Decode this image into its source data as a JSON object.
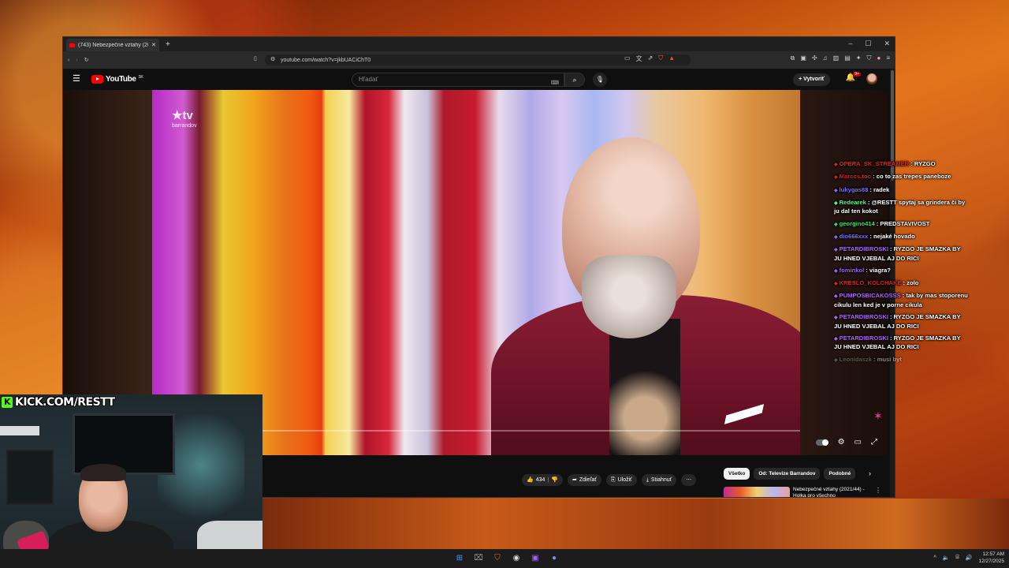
{
  "browser": {
    "tab_title": "(743) Nebezpečné vztahy (2021/...",
    "new_tab": "+",
    "url": "youtube.com/watch?v=jkbUACiChT0",
    "window_controls": [
      "–",
      "☐",
      "✕"
    ]
  },
  "youtube": {
    "logo_text": "YouTube",
    "region": "SK",
    "search_placeholder": "Hľadať",
    "create_label": "Vytvoriť",
    "notif_count": "9+",
    "video": {
      "channel_watermark": "tv",
      "channel_watermark_sub": "barrandov",
      "autoplay_on": true
    },
    "actions": {
      "likes": "434",
      "share": "Zdieľať",
      "save": "Uložiť",
      "download": "Stiahnuť"
    },
    "chips": [
      "Všetko",
      "Od: Televize Barrandov",
      "Podobné"
    ],
    "recommended": {
      "title": "Nebezpečné vztahy (2021/44) - Holka pro všechno"
    }
  },
  "stream": {
    "kick_url": "KICK.COM/RESTT"
  },
  "chat": [
    {
      "user": "OPERA_SK_STREAMER",
      "color": "#e02020",
      "text": "RYZGO"
    },
    {
      "user": "Marcos.too",
      "color": "#d02020",
      "text": "co to zas trepes paneboze"
    },
    {
      "user": "lukygas88",
      "color": "#7a6cff",
      "text": "radek"
    },
    {
      "user": "Redearek",
      "color": "#44ff88",
      "text": "@RESTT spytaj sa grindera či by ju dal ten kokot"
    },
    {
      "user": "georgino414",
      "color": "#33e060",
      "text": "PREDSTAVIVOST"
    },
    {
      "user": "dio666xxx",
      "color": "#7a6cff",
      "text": "nejaké hovado"
    },
    {
      "user": "PETARDIBROSKI",
      "color": "#b060ff",
      "text": "RYZGO JE SMAZKA BY JU HNED VJEBAL AJ DO RICI"
    },
    {
      "user": "fominkol",
      "color": "#a060ff",
      "text": "viagra?"
    },
    {
      "user": "KRESLO_KOLCHAKE",
      "color": "#e02020",
      "text": "zolo"
    },
    {
      "user": "PUMPOSBICAKOSSS",
      "color": "#b060ff",
      "text": "tak by mas stoporenu cikulu len ked je v porne cikula"
    },
    {
      "user": "PETARDIBROSKI",
      "color": "#b060ff",
      "text": "RYZGO JE SMAZKA BY JU HNED VJEBAL AJ DO RICI"
    },
    {
      "user": "PETARDIBROSKI",
      "color": "#b060ff",
      "text": "RYZGO JE SMAZKA BY JU HNED VJEBAL AJ DO RICI"
    },
    {
      "user": "Leonidaszk",
      "color": "#999999",
      "text": "musi byt"
    }
  ],
  "taskbar": {
    "time": "12:57 AM",
    "date": "12/27/2025"
  },
  "colors": {
    "youtube_red": "#ff0000",
    "kick_green": "#53fc18"
  }
}
